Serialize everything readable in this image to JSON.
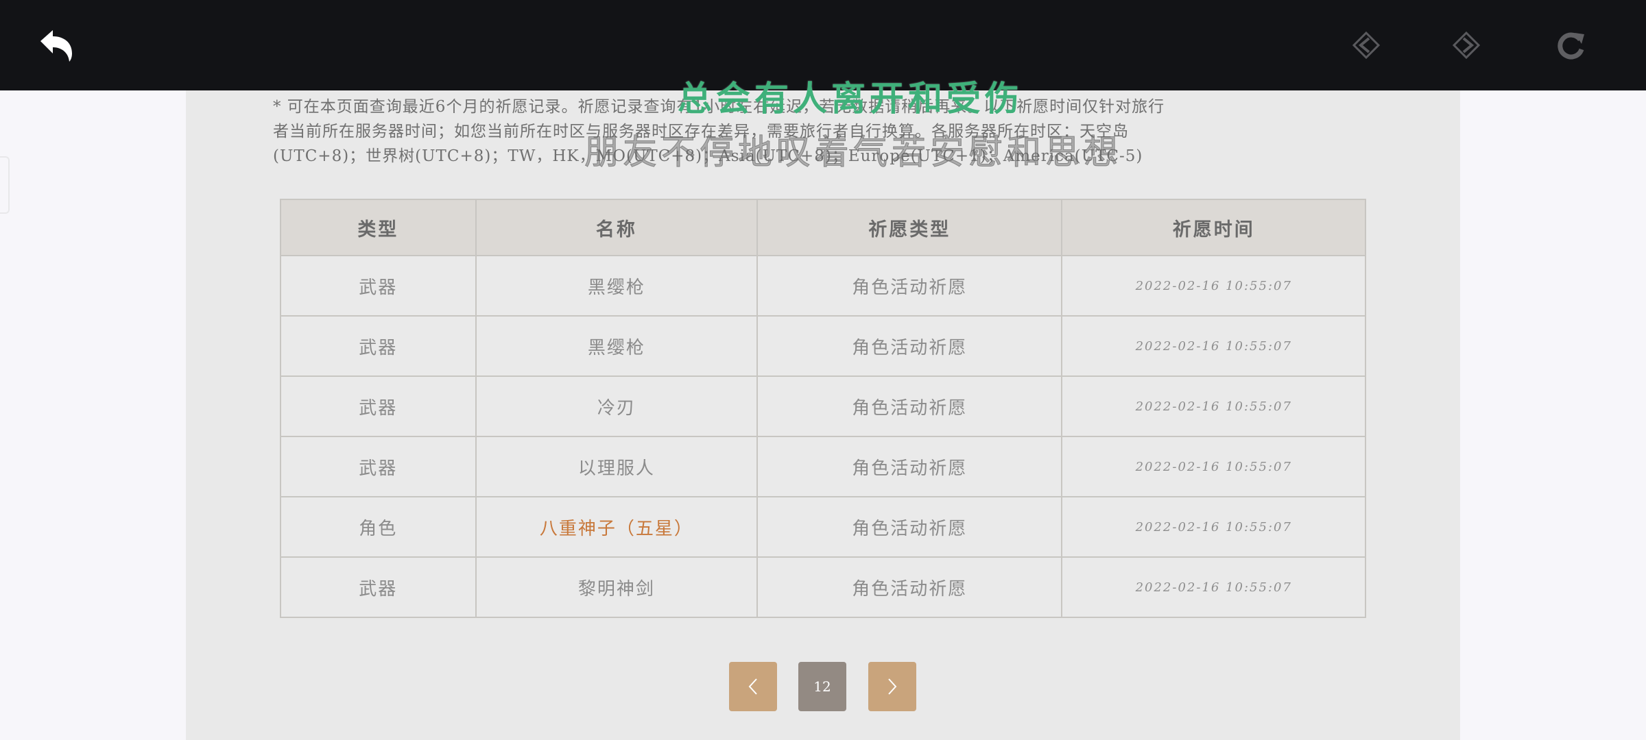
{
  "notice": {
    "line1": "* 可在本页面查询最近6个月的祈愿记录。祈愿记录查询有1小时左右延迟，若无数据请稍后再来。以下祈愿时间仅针对旅行",
    "line2": "者当前所在服务器时间；如您当前所在时区与服务器时区存在差异，需要旅行者自行换算。各服务器所在时区：天空岛",
    "line3": "(UTC+8)；世界树(UTC+8)；TW，HK，MO(UTC+8)；Asia(UTC+8)；Europe(UTC+1)；America(UTC-5)"
  },
  "overlay": {
    "green_text": "总会有人离开和受伤",
    "outline_text": "朋友不停地叹着气若安慰和思想"
  },
  "table": {
    "headers": [
      "类型",
      "名称",
      "祈愿类型",
      "祈愿时间"
    ],
    "rows": [
      {
        "type": "武器",
        "name": "黑缨枪",
        "wish_type": "角色活动祈愿",
        "time": "2022-02-16 10:55:07"
      },
      {
        "type": "武器",
        "name": "黑缨枪",
        "wish_type": "角色活动祈愿",
        "time": "2022-02-16 10:55:07"
      },
      {
        "type": "武器",
        "name": "冷刃",
        "wish_type": "角色活动祈愿",
        "time": "2022-02-16 10:55:07"
      },
      {
        "type": "武器",
        "name": "以理服人",
        "wish_type": "角色活动祈愿",
        "time": "2022-02-16 10:55:07"
      },
      {
        "type": "角色",
        "name": "八重神子（五星）",
        "wish_type": "角色活动祈愿",
        "time": "2022-02-16 10:55:07"
      },
      {
        "type": "武器",
        "name": "黎明神剑",
        "wish_type": "角色活动祈愿",
        "time": "2022-02-16 10:55:07"
      }
    ]
  },
  "pagination": {
    "current_page": "12"
  },
  "colors": {
    "topbar": "#121316",
    "highlight_5star": "#c8783a",
    "pager_button": "#c9a47c",
    "pager_current": "#938a83"
  },
  "icons": {
    "back": "back-arrow-icon",
    "nav_prev": "diamond-prev-icon",
    "nav_next": "diamond-next-icon",
    "refresh": "refresh-icon",
    "pager_prev": "chevron-left-icon",
    "pager_next": "chevron-right-icon"
  }
}
